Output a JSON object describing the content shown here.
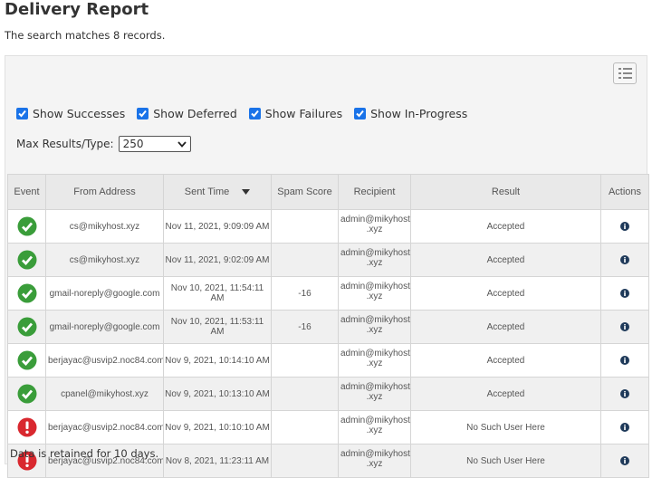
{
  "page": {
    "title": "Delivery Report",
    "summary": "The search matches 8 records.",
    "footer": "Data is retained for 10 days."
  },
  "filters": [
    {
      "label": "Show Successes",
      "checked": true
    },
    {
      "label": "Show Deferred",
      "checked": true
    },
    {
      "label": "Show Failures",
      "checked": true
    },
    {
      "label": "Show In-Progress",
      "checked": true
    }
  ],
  "max_results": {
    "label": "Max Results/Type:",
    "value": "250"
  },
  "table": {
    "headers": {
      "event": "Event",
      "from": "From Address",
      "sent": "Sent Time",
      "spam": "Spam Score",
      "recipient": "Recipient",
      "result": "Result",
      "actions": "Actions"
    },
    "rows": [
      {
        "status": "success",
        "from": "cs@mikyhost.xyz",
        "sent": "Nov 11, 2021, 9:09:09 AM",
        "spam": "",
        "recipient": "admin@mikyhost .xyz",
        "result": "Accepted"
      },
      {
        "status": "success",
        "from": "cs@mikyhost.xyz",
        "sent": "Nov 11, 2021, 9:02:09 AM",
        "spam": "",
        "recipient": "admin@mikyhost .xyz",
        "result": "Accepted"
      },
      {
        "status": "success",
        "from": "gmail-noreply@google.com",
        "sent": "Nov 10, 2021, 11:54:11 AM",
        "spam": "-16",
        "recipient": "admin@mikyhost .xyz",
        "result": "Accepted"
      },
      {
        "status": "success",
        "from": "gmail-noreply@google.com",
        "sent": "Nov 10, 2021, 11:53:11 AM",
        "spam": "-16",
        "recipient": "admin@mikyhost .xyz",
        "result": "Accepted"
      },
      {
        "status": "success",
        "from": "berjayac@usvip2.noc84.com",
        "sent": "Nov 9, 2021, 10:14:10 AM",
        "spam": "",
        "recipient": "admin@mikyhost .xyz",
        "result": "Accepted"
      },
      {
        "status": "success",
        "from": "cpanel@mikyhost.xyz",
        "sent": "Nov 9, 2021, 10:13:10 AM",
        "spam": "",
        "recipient": "admin@mikyhost .xyz",
        "result": "Accepted"
      },
      {
        "status": "failure",
        "from": "berjayac@usvip2.noc84.com",
        "sent": "Nov 9, 2021, 10:10:10 AM",
        "spam": "",
        "recipient": "admin@mikyhost .xyz",
        "result": "No Such User Here"
      },
      {
        "status": "failure",
        "from": "berjayac@usvip2.noc84.com",
        "sent": "Nov 8, 2021, 11:23:11 AM",
        "spam": "",
        "recipient": "admin@mikyhost .xyz",
        "result": "No Such User Here"
      }
    ]
  },
  "icons": {
    "success": "check-circle-icon",
    "failure": "exclamation-circle-icon",
    "info": "info-icon",
    "list_view": "list-view-icon",
    "sort": "sort-desc-icon"
  },
  "colors": {
    "success": "#3a9d3a",
    "failure": "#d9282f",
    "checkbox": "#1a73e8",
    "info": "#1f3a5a"
  }
}
